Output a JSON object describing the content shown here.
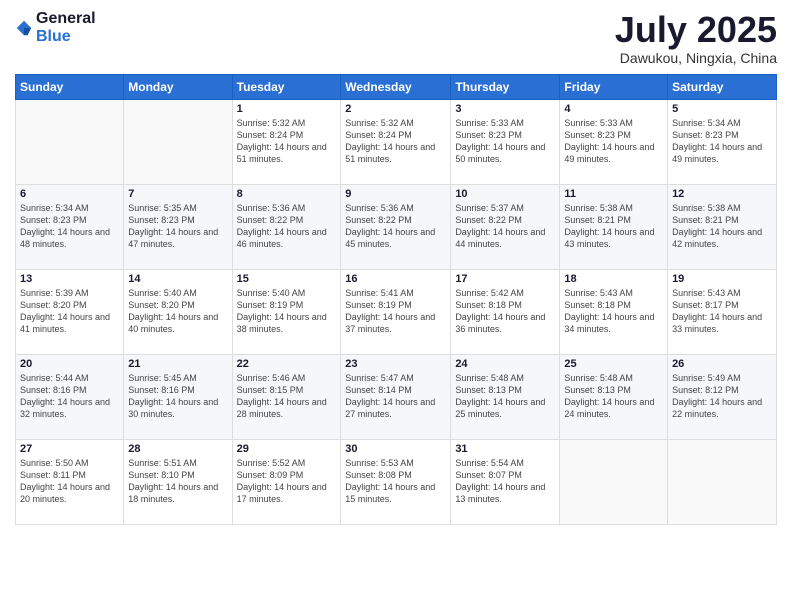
{
  "header": {
    "logo": {
      "general": "General",
      "blue": "Blue"
    },
    "title": "July 2025",
    "location": "Dawukou, Ningxia, China"
  },
  "weekdays": [
    "Sunday",
    "Monday",
    "Tuesday",
    "Wednesday",
    "Thursday",
    "Friday",
    "Saturday"
  ],
  "weeks": [
    [
      {
        "day": "",
        "sunrise": "",
        "sunset": "",
        "daylight": ""
      },
      {
        "day": "",
        "sunrise": "",
        "sunset": "",
        "daylight": ""
      },
      {
        "day": "1",
        "sunrise": "Sunrise: 5:32 AM",
        "sunset": "Sunset: 8:24 PM",
        "daylight": "Daylight: 14 hours and 51 minutes."
      },
      {
        "day": "2",
        "sunrise": "Sunrise: 5:32 AM",
        "sunset": "Sunset: 8:24 PM",
        "daylight": "Daylight: 14 hours and 51 minutes."
      },
      {
        "day": "3",
        "sunrise": "Sunrise: 5:33 AM",
        "sunset": "Sunset: 8:23 PM",
        "daylight": "Daylight: 14 hours and 50 minutes."
      },
      {
        "day": "4",
        "sunrise": "Sunrise: 5:33 AM",
        "sunset": "Sunset: 8:23 PM",
        "daylight": "Daylight: 14 hours and 49 minutes."
      },
      {
        "day": "5",
        "sunrise": "Sunrise: 5:34 AM",
        "sunset": "Sunset: 8:23 PM",
        "daylight": "Daylight: 14 hours and 49 minutes."
      }
    ],
    [
      {
        "day": "6",
        "sunrise": "Sunrise: 5:34 AM",
        "sunset": "Sunset: 8:23 PM",
        "daylight": "Daylight: 14 hours and 48 minutes."
      },
      {
        "day": "7",
        "sunrise": "Sunrise: 5:35 AM",
        "sunset": "Sunset: 8:23 PM",
        "daylight": "Daylight: 14 hours and 47 minutes."
      },
      {
        "day": "8",
        "sunrise": "Sunrise: 5:36 AM",
        "sunset": "Sunset: 8:22 PM",
        "daylight": "Daylight: 14 hours and 46 minutes."
      },
      {
        "day": "9",
        "sunrise": "Sunrise: 5:36 AM",
        "sunset": "Sunset: 8:22 PM",
        "daylight": "Daylight: 14 hours and 45 minutes."
      },
      {
        "day": "10",
        "sunrise": "Sunrise: 5:37 AM",
        "sunset": "Sunset: 8:22 PM",
        "daylight": "Daylight: 14 hours and 44 minutes."
      },
      {
        "day": "11",
        "sunrise": "Sunrise: 5:38 AM",
        "sunset": "Sunset: 8:21 PM",
        "daylight": "Daylight: 14 hours and 43 minutes."
      },
      {
        "day": "12",
        "sunrise": "Sunrise: 5:38 AM",
        "sunset": "Sunset: 8:21 PM",
        "daylight": "Daylight: 14 hours and 42 minutes."
      }
    ],
    [
      {
        "day": "13",
        "sunrise": "Sunrise: 5:39 AM",
        "sunset": "Sunset: 8:20 PM",
        "daylight": "Daylight: 14 hours and 41 minutes."
      },
      {
        "day": "14",
        "sunrise": "Sunrise: 5:40 AM",
        "sunset": "Sunset: 8:20 PM",
        "daylight": "Daylight: 14 hours and 40 minutes."
      },
      {
        "day": "15",
        "sunrise": "Sunrise: 5:40 AM",
        "sunset": "Sunset: 8:19 PM",
        "daylight": "Daylight: 14 hours and 38 minutes."
      },
      {
        "day": "16",
        "sunrise": "Sunrise: 5:41 AM",
        "sunset": "Sunset: 8:19 PM",
        "daylight": "Daylight: 14 hours and 37 minutes."
      },
      {
        "day": "17",
        "sunrise": "Sunrise: 5:42 AM",
        "sunset": "Sunset: 8:18 PM",
        "daylight": "Daylight: 14 hours and 36 minutes."
      },
      {
        "day": "18",
        "sunrise": "Sunrise: 5:43 AM",
        "sunset": "Sunset: 8:18 PM",
        "daylight": "Daylight: 14 hours and 34 minutes."
      },
      {
        "day": "19",
        "sunrise": "Sunrise: 5:43 AM",
        "sunset": "Sunset: 8:17 PM",
        "daylight": "Daylight: 14 hours and 33 minutes."
      }
    ],
    [
      {
        "day": "20",
        "sunrise": "Sunrise: 5:44 AM",
        "sunset": "Sunset: 8:16 PM",
        "daylight": "Daylight: 14 hours and 32 minutes."
      },
      {
        "day": "21",
        "sunrise": "Sunrise: 5:45 AM",
        "sunset": "Sunset: 8:16 PM",
        "daylight": "Daylight: 14 hours and 30 minutes."
      },
      {
        "day": "22",
        "sunrise": "Sunrise: 5:46 AM",
        "sunset": "Sunset: 8:15 PM",
        "daylight": "Daylight: 14 hours and 28 minutes."
      },
      {
        "day": "23",
        "sunrise": "Sunrise: 5:47 AM",
        "sunset": "Sunset: 8:14 PM",
        "daylight": "Daylight: 14 hours and 27 minutes."
      },
      {
        "day": "24",
        "sunrise": "Sunrise: 5:48 AM",
        "sunset": "Sunset: 8:13 PM",
        "daylight": "Daylight: 14 hours and 25 minutes."
      },
      {
        "day": "25",
        "sunrise": "Sunrise: 5:48 AM",
        "sunset": "Sunset: 8:13 PM",
        "daylight": "Daylight: 14 hours and 24 minutes."
      },
      {
        "day": "26",
        "sunrise": "Sunrise: 5:49 AM",
        "sunset": "Sunset: 8:12 PM",
        "daylight": "Daylight: 14 hours and 22 minutes."
      }
    ],
    [
      {
        "day": "27",
        "sunrise": "Sunrise: 5:50 AM",
        "sunset": "Sunset: 8:11 PM",
        "daylight": "Daylight: 14 hours and 20 minutes."
      },
      {
        "day": "28",
        "sunrise": "Sunrise: 5:51 AM",
        "sunset": "Sunset: 8:10 PM",
        "daylight": "Daylight: 14 hours and 18 minutes."
      },
      {
        "day": "29",
        "sunrise": "Sunrise: 5:52 AM",
        "sunset": "Sunset: 8:09 PM",
        "daylight": "Daylight: 14 hours and 17 minutes."
      },
      {
        "day": "30",
        "sunrise": "Sunrise: 5:53 AM",
        "sunset": "Sunset: 8:08 PM",
        "daylight": "Daylight: 14 hours and 15 minutes."
      },
      {
        "day": "31",
        "sunrise": "Sunrise: 5:54 AM",
        "sunset": "Sunset: 8:07 PM",
        "daylight": "Daylight: 14 hours and 13 minutes."
      },
      {
        "day": "",
        "sunrise": "",
        "sunset": "",
        "daylight": ""
      },
      {
        "day": "",
        "sunrise": "",
        "sunset": "",
        "daylight": ""
      }
    ]
  ]
}
